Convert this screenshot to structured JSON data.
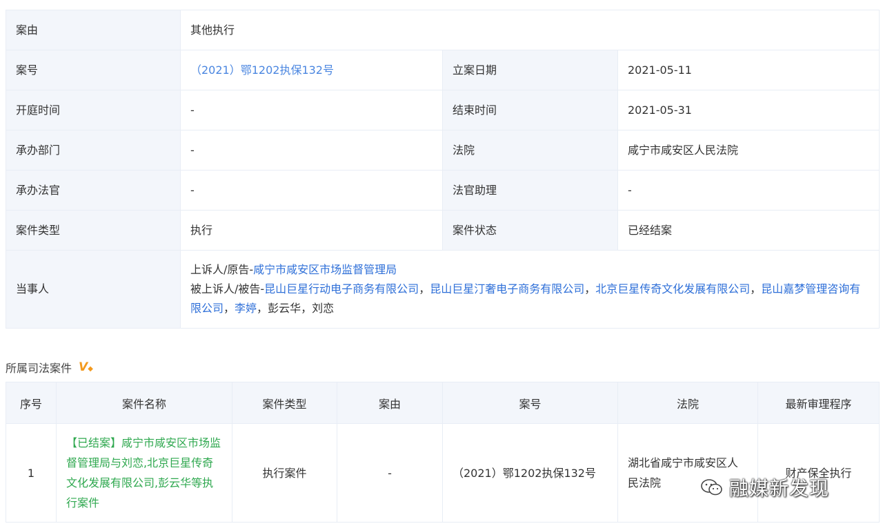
{
  "details": {
    "cause_label": "案由",
    "cause_value": "其他执行",
    "case_no_label": "案号",
    "case_no_value": "（2021）鄂1202执保132号",
    "filing_date_label": "立案日期",
    "filing_date_value": "2021-05-11",
    "hearing_time_label": "开庭时间",
    "hearing_time_value": "-",
    "end_time_label": "结束时间",
    "end_time_value": "2021-05-31",
    "department_label": "承办部门",
    "department_value": "-",
    "court_label": "法院",
    "court_value": "咸宁市咸安区人民法院",
    "judge_label": "承办法官",
    "judge_value": "-",
    "assistant_label": "法官助理",
    "assistant_value": "-",
    "case_type_label": "案件类型",
    "case_type_value": "执行",
    "case_status_label": "案件状态",
    "case_status_value": "已经结案",
    "parties_label": "当事人",
    "appellant_prefix": "上诉人/原告-",
    "appellant_name": "咸宁市咸安区市场监督管理局",
    "appellee_prefix": "被上诉人/被告-",
    "appellees": [
      "昆山巨星行动电子商务有限公司",
      "昆山巨星汀奢电子商务有限公司",
      "北京巨星传奇文化发展有限公司",
      "昆山嘉梦管理咨询有限公司",
      "李婷"
    ],
    "sep": "，",
    "appellees_plain": "彭云华，刘恋"
  },
  "related": {
    "title": "所属司法案件",
    "vip_badge": "V",
    "headers": [
      "序号",
      "案件名称",
      "案件类型",
      "案由",
      "案号",
      "法院",
      "最新审理程序"
    ],
    "rows": [
      {
        "index": "1",
        "status_tag": "【已结案】",
        "name": "咸宁市咸安区市场监督管理局与刘恋,北京巨星传奇文化发展有限公司,彭云华等执行案件",
        "type": "执行案件",
        "cause": "-",
        "case_no": "（2021）鄂1202执保132号",
        "court": "湖北省咸宁市咸安区人民法院",
        "procedure": "财产保全执行"
      }
    ]
  },
  "watermark": {
    "text": "融媒新发现",
    "icon": "wechat-icon"
  },
  "colors": {
    "link_blue": "#2e6fd8",
    "green": "#2fa84f",
    "label_bg": "#f3f6fb",
    "border": "#e8edf5"
  }
}
